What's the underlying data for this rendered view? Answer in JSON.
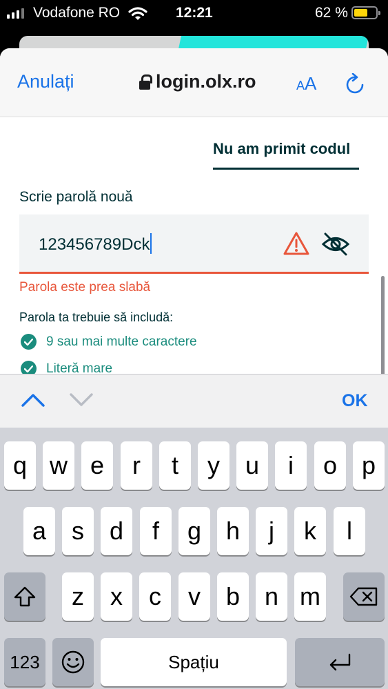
{
  "status_bar": {
    "carrier": "Vodafone RO",
    "time": "12:21",
    "battery_percent": "62 %",
    "battery_level": 0.62
  },
  "safari": {
    "cancel_label": "Anulați",
    "url": "login.olx.ro",
    "text_size_small": "A",
    "text_size_large": "A",
    "lock_icon": "lock-icon",
    "reload_icon": "reload-icon"
  },
  "page": {
    "resend_link": "Nu am primit codul",
    "password_label": "Scrie parolă nouă",
    "password_value": "123456789Dck",
    "error_message": "Parola este prea slabă",
    "rules_title": "Parola ta trebuie să includă:",
    "rules": [
      {
        "label": "9 sau mai multe caractere",
        "met": true
      },
      {
        "label": "Literă mare",
        "met": true
      }
    ]
  },
  "accessory": {
    "ok_label": "OK"
  },
  "keyboard": {
    "row1": [
      "q",
      "w",
      "e",
      "r",
      "t",
      "y",
      "u",
      "i",
      "o",
      "p"
    ],
    "row2": [
      "a",
      "s",
      "d",
      "f",
      "g",
      "h",
      "j",
      "k",
      "l"
    ],
    "row3": [
      "z",
      "x",
      "c",
      "v",
      "b",
      "n",
      "m"
    ],
    "numbers_key": "123",
    "emoji_key": "☺",
    "space_key": "Spațiu"
  },
  "colors": {
    "link_blue": "#1a73e8",
    "error": "#e8563b",
    "success": "#1a8c7d",
    "olx_dark": "#002f34",
    "olx_teal": "#23e5db"
  }
}
